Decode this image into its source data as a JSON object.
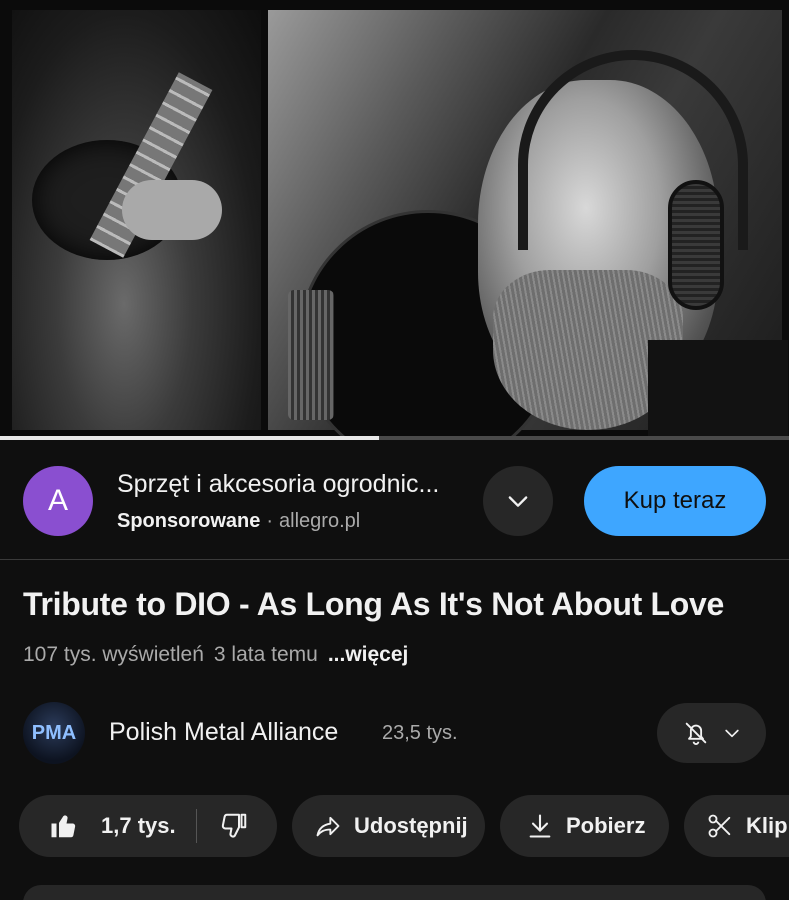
{
  "video": {
    "progress_fraction": 0.48
  },
  "ad": {
    "avatar_letter": "A",
    "avatar_color": "#8a4fd0",
    "title": "Sprzęt i akcesoria ogrodnic...",
    "sponsored_label": "Sponsorowane",
    "separator": "·",
    "domain": "allegro.pl",
    "expand_icon": "chevron-down-icon",
    "cta_label": "Kup teraz",
    "cta_color": "#3ea6ff"
  },
  "video_info": {
    "title": "Tribute to DIO - As Long As It's Not About Love",
    "views": "107 tys. wyświetleń",
    "age": "3 lata temu",
    "more_label": "...więcej"
  },
  "channel": {
    "name": "Polish Metal Alliance",
    "subscribers": "23,5 tys.",
    "avatar_letters": "PMA",
    "notification_icon": "bell-off-icon"
  },
  "actions": {
    "like_count": "1,7 tys.",
    "share_label": "Udostępnij",
    "download_label": "Pobierz",
    "clip_label": "Klip"
  }
}
